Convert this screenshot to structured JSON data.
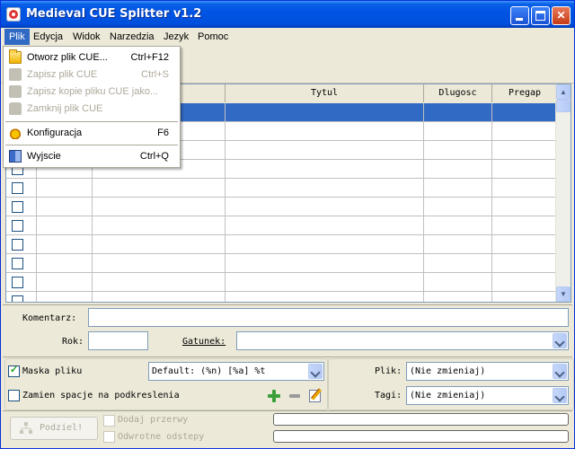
{
  "window": {
    "title": "Medieval CUE Splitter v1.2",
    "icon": "medieval-app-icon"
  },
  "menubar": {
    "items": [
      {
        "label": "Plik"
      },
      {
        "label": "Edycja"
      },
      {
        "label": "Widok"
      },
      {
        "label": "Narzedzia"
      },
      {
        "label": "Jezyk"
      },
      {
        "label": "Pomoc"
      }
    ]
  },
  "file_menu": {
    "items": [
      {
        "label": "Otworz plik CUE...",
        "shortcut": "Ctrl+F12",
        "enabled": true,
        "icon": "open-folder-icon"
      },
      {
        "label": "Zapisz plik CUE",
        "shortcut": "Ctrl+S",
        "enabled": false,
        "icon": "save-icon"
      },
      {
        "label": "Zapisz kopie pliku CUE jako...",
        "shortcut": "",
        "enabled": false,
        "icon": "save-copy-icon"
      },
      {
        "label": "Zamknij plik CUE",
        "shortcut": "",
        "enabled": false,
        "icon": "close-file-icon"
      },
      {
        "label": "Konfiguracja",
        "shortcut": "F6",
        "enabled": true,
        "icon": "config-icon"
      },
      {
        "label": "Wyjscie",
        "shortcut": "Ctrl+Q",
        "enabled": true,
        "icon": "exit-icon"
      }
    ]
  },
  "table": {
    "columns": [
      {
        "label": ""
      },
      {
        "label": ""
      },
      {
        "label": ""
      },
      {
        "label": "Tytul"
      },
      {
        "label": "Dlugosc"
      },
      {
        "label": "Pregap"
      }
    ],
    "row_count": 11,
    "selected_row": 0
  },
  "track_info": {
    "comment_label": "Komentarz:",
    "comment_value": "",
    "year_label": "Rok:",
    "year_value": "",
    "genre_label": "Gatunek:",
    "genre_value": ""
  },
  "options": {
    "file_mask_label": "Maska pliku",
    "file_mask_checked": true,
    "file_mask_value": "Default: (%n) [%a] %t",
    "replace_spaces_label": "Zamien spacje na podkreslenia",
    "replace_spaces_checked": false,
    "file_label": "Plik:",
    "file_value": "(Nie zmieniaj)",
    "tags_label": "Tagi:",
    "tags_value": "(Nie zmieniaj)"
  },
  "actions": {
    "split_label": "Podziel!",
    "add_gaps_label": "Dodaj przerwy",
    "reverse_gaps_label": "Odwrotne odstepy"
  }
}
